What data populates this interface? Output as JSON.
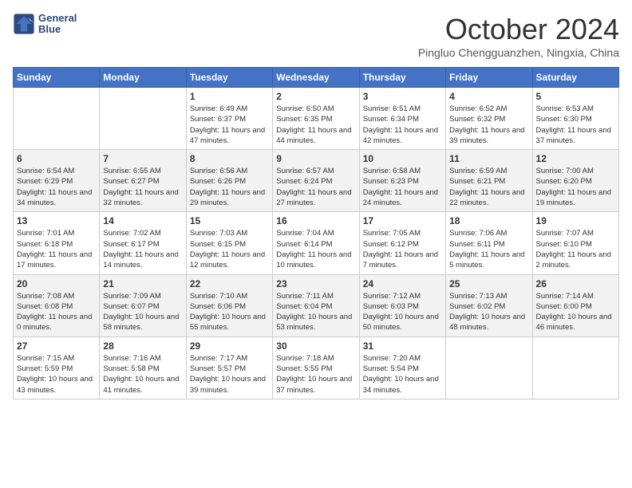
{
  "header": {
    "logo_line1": "General",
    "logo_line2": "Blue",
    "month_title": "October 2024",
    "subtitle": "Pingluo Chengguanzhen, Ningxia, China"
  },
  "days_of_week": [
    "Sunday",
    "Monday",
    "Tuesday",
    "Wednesday",
    "Thursday",
    "Friday",
    "Saturday"
  ],
  "weeks": [
    [
      {
        "day": "",
        "info": ""
      },
      {
        "day": "",
        "info": ""
      },
      {
        "day": "1",
        "info": "Sunrise: 6:49 AM\nSunset: 6:37 PM\nDaylight: 11 hours and 47 minutes."
      },
      {
        "day": "2",
        "info": "Sunrise: 6:50 AM\nSunset: 6:35 PM\nDaylight: 11 hours and 44 minutes."
      },
      {
        "day": "3",
        "info": "Sunrise: 6:51 AM\nSunset: 6:34 PM\nDaylight: 11 hours and 42 minutes."
      },
      {
        "day": "4",
        "info": "Sunrise: 6:52 AM\nSunset: 6:32 PM\nDaylight: 11 hours and 39 minutes."
      },
      {
        "day": "5",
        "info": "Sunrise: 6:53 AM\nSunset: 6:30 PM\nDaylight: 11 hours and 37 minutes."
      }
    ],
    [
      {
        "day": "6",
        "info": "Sunrise: 6:54 AM\nSunset: 6:29 PM\nDaylight: 11 hours and 34 minutes."
      },
      {
        "day": "7",
        "info": "Sunrise: 6:55 AM\nSunset: 6:27 PM\nDaylight: 11 hours and 32 minutes."
      },
      {
        "day": "8",
        "info": "Sunrise: 6:56 AM\nSunset: 6:26 PM\nDaylight: 11 hours and 29 minutes."
      },
      {
        "day": "9",
        "info": "Sunrise: 6:57 AM\nSunset: 6:24 PM\nDaylight: 11 hours and 27 minutes."
      },
      {
        "day": "10",
        "info": "Sunrise: 6:58 AM\nSunset: 6:23 PM\nDaylight: 11 hours and 24 minutes."
      },
      {
        "day": "11",
        "info": "Sunrise: 6:59 AM\nSunset: 6:21 PM\nDaylight: 11 hours and 22 minutes."
      },
      {
        "day": "12",
        "info": "Sunrise: 7:00 AM\nSunset: 6:20 PM\nDaylight: 11 hours and 19 minutes."
      }
    ],
    [
      {
        "day": "13",
        "info": "Sunrise: 7:01 AM\nSunset: 6:18 PM\nDaylight: 11 hours and 17 minutes."
      },
      {
        "day": "14",
        "info": "Sunrise: 7:02 AM\nSunset: 6:17 PM\nDaylight: 11 hours and 14 minutes."
      },
      {
        "day": "15",
        "info": "Sunrise: 7:03 AM\nSunset: 6:15 PM\nDaylight: 11 hours and 12 minutes."
      },
      {
        "day": "16",
        "info": "Sunrise: 7:04 AM\nSunset: 6:14 PM\nDaylight: 11 hours and 10 minutes."
      },
      {
        "day": "17",
        "info": "Sunrise: 7:05 AM\nSunset: 6:12 PM\nDaylight: 11 hours and 7 minutes."
      },
      {
        "day": "18",
        "info": "Sunrise: 7:06 AM\nSunset: 6:11 PM\nDaylight: 11 hours and 5 minutes."
      },
      {
        "day": "19",
        "info": "Sunrise: 7:07 AM\nSunset: 6:10 PM\nDaylight: 11 hours and 2 minutes."
      }
    ],
    [
      {
        "day": "20",
        "info": "Sunrise: 7:08 AM\nSunset: 6:08 PM\nDaylight: 11 hours and 0 minutes."
      },
      {
        "day": "21",
        "info": "Sunrise: 7:09 AM\nSunset: 6:07 PM\nDaylight: 10 hours and 58 minutes."
      },
      {
        "day": "22",
        "info": "Sunrise: 7:10 AM\nSunset: 6:06 PM\nDaylight: 10 hours and 55 minutes."
      },
      {
        "day": "23",
        "info": "Sunrise: 7:11 AM\nSunset: 6:04 PM\nDaylight: 10 hours and 53 minutes."
      },
      {
        "day": "24",
        "info": "Sunrise: 7:12 AM\nSunset: 6:03 PM\nDaylight: 10 hours and 50 minutes."
      },
      {
        "day": "25",
        "info": "Sunrise: 7:13 AM\nSunset: 6:02 PM\nDaylight: 10 hours and 48 minutes."
      },
      {
        "day": "26",
        "info": "Sunrise: 7:14 AM\nSunset: 6:00 PM\nDaylight: 10 hours and 46 minutes."
      }
    ],
    [
      {
        "day": "27",
        "info": "Sunrise: 7:15 AM\nSunset: 5:59 PM\nDaylight: 10 hours and 43 minutes."
      },
      {
        "day": "28",
        "info": "Sunrise: 7:16 AM\nSunset: 5:58 PM\nDaylight: 10 hours and 41 minutes."
      },
      {
        "day": "29",
        "info": "Sunrise: 7:17 AM\nSunset: 5:57 PM\nDaylight: 10 hours and 39 minutes."
      },
      {
        "day": "30",
        "info": "Sunrise: 7:18 AM\nSunset: 5:55 PM\nDaylight: 10 hours and 37 minutes."
      },
      {
        "day": "31",
        "info": "Sunrise: 7:20 AM\nSunset: 5:54 PM\nDaylight: 10 hours and 34 minutes."
      },
      {
        "day": "",
        "info": ""
      },
      {
        "day": "",
        "info": ""
      }
    ]
  ]
}
